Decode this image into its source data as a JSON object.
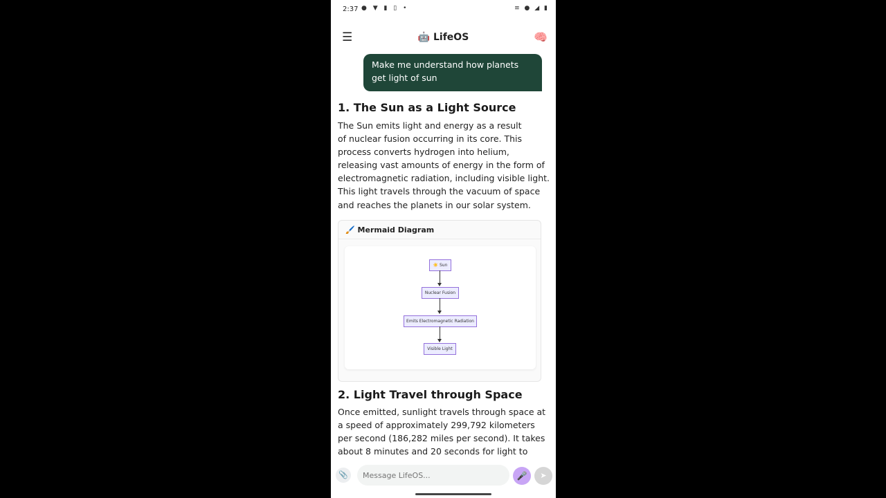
{
  "status_bar": {
    "time": "2:37",
    "left_icons": "● ▼ ▮ ▯ •",
    "right_icons": "≡ ● ◢ ▮"
  },
  "header": {
    "menu_icon": "☰",
    "title": "🤖 LifeOS",
    "brain_icon": "🧠"
  },
  "chat": {
    "user_message": "Make me understand how planets get light of sun",
    "section1": {
      "heading": "1. The Sun as a Light Source",
      "lines": [
        "The Sun emits light and energy as a result",
        "of nuclear fusion occurring in its core. This",
        "process converts hydrogen into helium,",
        "releasing vast amounts of energy in the form of",
        "electromagnetic radiation, including visible light.",
        "This light travels through the vacuum of space",
        "and reaches the planets in our solar system."
      ]
    },
    "diagram": {
      "header_icon": "🖌️",
      "header_label": "Mermaid Diagram",
      "nodes": [
        "☀️ Sun",
        "Nuclear Fusion",
        "Emits Electromagnetic Radiation",
        "Visible Light"
      ]
    },
    "section2": {
      "heading": "2. Light Travel through Space",
      "lines": [
        "Once emitted, sunlight travels through space at",
        "a speed of approximately 299,792 kilometers",
        "per second (186,282 miles per second). It takes",
        "about 8 minutes and 20 seconds for light to"
      ]
    }
  },
  "input": {
    "placeholder": "Message LifeOS...",
    "attach_icon": "📎",
    "mic_icon": "🎤",
    "send_icon": "➤"
  }
}
